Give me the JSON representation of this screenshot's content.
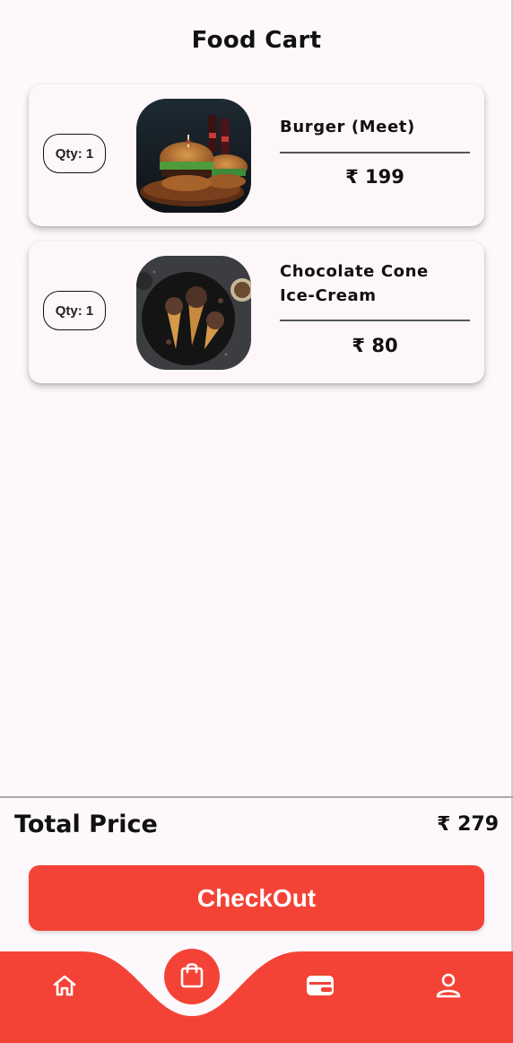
{
  "header": {
    "title": "Food Cart"
  },
  "cart": {
    "items": [
      {
        "qty_label": "Qty: 1",
        "name": "Burger (Meet)",
        "price": "₹ 199",
        "image_icon": "burger-image"
      },
      {
        "qty_label": "Qty: 1",
        "name": "Chocolate Cone Ice-Cream",
        "price": "₹ 80",
        "image_icon": "ice-cream-cone-image"
      }
    ]
  },
  "summary": {
    "total_label": "Total Price",
    "total_value": "₹ 279",
    "checkout_label": "CheckOut"
  },
  "bottom_nav": {
    "items": [
      {
        "icon": "home-icon"
      },
      {
        "icon": "shopping-bag-icon",
        "active": true
      },
      {
        "icon": "wallet-icon"
      },
      {
        "icon": "user-icon"
      }
    ]
  },
  "colors": {
    "accent": "#f44336",
    "background": "#fdf8fb",
    "card": "#fdf7fa",
    "text": "#111111"
  }
}
